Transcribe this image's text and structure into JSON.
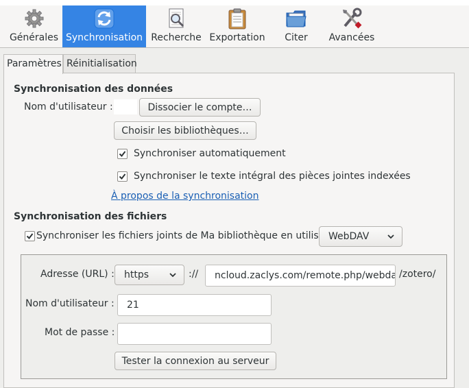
{
  "toolbar": {
    "items": [
      {
        "label": "Générales",
        "icon": "gear-icon"
      },
      {
        "label": "Synchronisation",
        "icon": "sync-icon"
      },
      {
        "label": "Recherche",
        "icon": "search-document-icon"
      },
      {
        "label": "Exportation",
        "icon": "clipboard-icon"
      },
      {
        "label": "Citer",
        "icon": "folder-icon"
      },
      {
        "label": "Avancées",
        "icon": "tools-icon"
      }
    ],
    "selected": "Synchronisation"
  },
  "tabs": [
    {
      "label": "Paramètres",
      "active": true
    },
    {
      "label": "Réinitialisation",
      "active": false
    }
  ],
  "data_sync": {
    "heading": "Synchronisation des données",
    "username_label": "Nom d'utilisateur :",
    "username_value": "",
    "unlink_button": "Dissocier le compte…",
    "choose_libraries_button": "Choisir les bibliothèques…",
    "auto_sync": {
      "label": "Synchroniser automatiquement",
      "checked": true
    },
    "fulltext_sync": {
      "label": "Synchroniser le texte intégral des pièces jointes indexées",
      "checked": true
    },
    "about_link": "À propos de la synchronisation"
  },
  "file_sync": {
    "heading": "Synchronisation des fichiers",
    "sync_files": {
      "label": "Synchroniser les fichiers joints de Ma bibliothèque en utilisant",
      "checked": true
    },
    "method_selected": "WebDAV",
    "url_label": "Adresse (URL) :",
    "protocol_selected": "https",
    "scheme_separator": "://",
    "url_value": "ncloud.zaclys.com/remote.php/webdav",
    "url_suffix": "/zotero/",
    "username_label": "Nom d'utilisateur :",
    "username_value": "21",
    "password_label": "Mot de passe :",
    "password_value": "",
    "test_button": "Tester la connexion au serveur"
  },
  "colors": {
    "selected_bg": "#3584e4",
    "link": "#1a5fb4",
    "window_bg": "#eeeeec"
  }
}
